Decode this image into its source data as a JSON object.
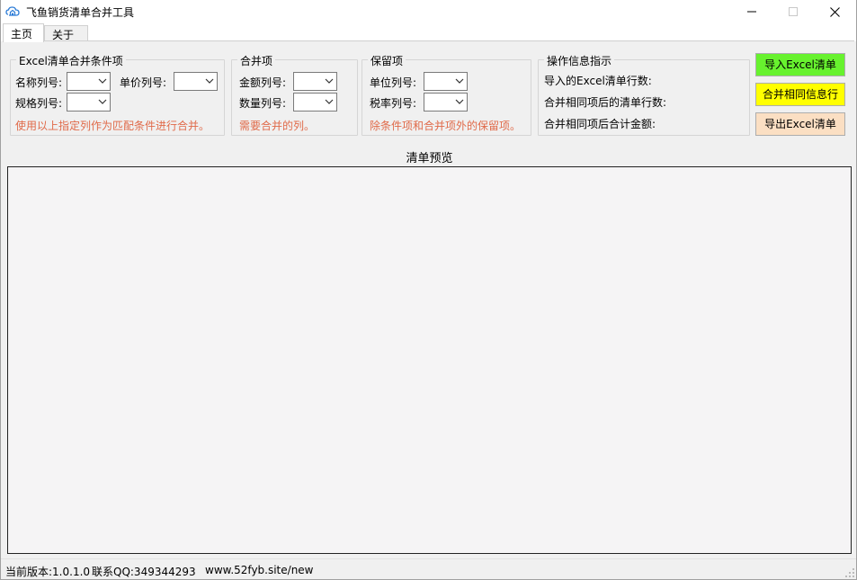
{
  "window": {
    "title": "飞鱼销货清单合并工具",
    "icon": "cloud-home-icon",
    "controls": [
      "minimize-icon",
      "maximize-icon",
      "close-icon"
    ]
  },
  "tabs": [
    {
      "label": "主页",
      "selected": true
    },
    {
      "label": "关于",
      "selected": false
    }
  ],
  "groups": {
    "criteria": {
      "title": "Excel清单合并条件项",
      "fields": [
        {
          "label": "名称列号:",
          "value": ""
        },
        {
          "label": "单价列号:",
          "value": ""
        },
        {
          "label": "规格列号:",
          "value": ""
        }
      ],
      "hint": "使用以上指定列作为匹配条件进行合并。"
    },
    "merge": {
      "title": "合并项",
      "fields": [
        {
          "label": "金额列号:",
          "value": ""
        },
        {
          "label": "数量列号:",
          "value": ""
        }
      ],
      "hint": "需要合并的列。"
    },
    "keep": {
      "title": "保留项",
      "fields": [
        {
          "label": "单位列号:",
          "value": ""
        },
        {
          "label": "税率列号:",
          "value": ""
        }
      ],
      "hint": "除条件项和合并项外的保留项。"
    },
    "info": {
      "title": "操作信息指示",
      "lines": [
        "导入的Excel清单行数:",
        "合并相同项后的清单行数:",
        "合并相同项后合计金额:"
      ]
    }
  },
  "actions": {
    "import_label": "导入Excel清单",
    "merge_label": "合并相同信息行",
    "export_label": "导出Excel清单"
  },
  "colors": {
    "import": "#67f22e",
    "merge": "#ffff00",
    "export": "#fbdfc3",
    "hint": "#e06a49"
  },
  "preview": {
    "title": "清单预览"
  },
  "status": {
    "version": "当前版本:1.0.1.0",
    "contact": "联系QQ:349344293",
    "site": "www.52fyb.site/new"
  }
}
